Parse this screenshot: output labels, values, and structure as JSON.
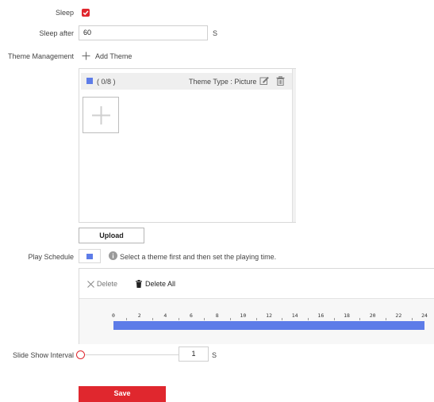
{
  "sleep": {
    "label": "Sleep",
    "checked": true
  },
  "sleep_after": {
    "label": "Sleep after",
    "value": "60",
    "unit": "S"
  },
  "theme_management": {
    "label": "Theme Management",
    "add_label": "Add Theme",
    "count": "( 0/8 )",
    "theme_type": "Theme Type : Picture",
    "upload_label": "Upload"
  },
  "play_schedule": {
    "label": "Play Schedule",
    "hint": "Select a theme first and then set the playing time.",
    "delete_label": "Delete",
    "delete_all_label": "Delete All",
    "ticks": [
      "0",
      "2",
      "4",
      "6",
      "8",
      "10",
      "12",
      "14",
      "16",
      "18",
      "20",
      "22",
      "24"
    ]
  },
  "slide_show": {
    "label": "Slide Show Interval",
    "value": "1",
    "unit": "S",
    "slider_fraction": 0
  },
  "save_label": "Save",
  "colors": {
    "accent_red": "#e0272e",
    "schedule_blue": "#5d7ce8"
  }
}
